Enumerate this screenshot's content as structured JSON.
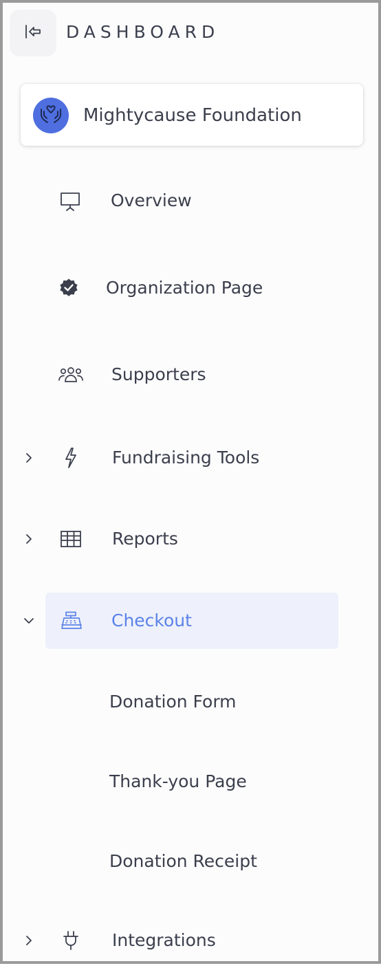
{
  "header": {
    "title": "DASHBOARD",
    "collapse_icon": "collapse-sidebar-icon"
  },
  "organization": {
    "name": "Mightycause Foundation",
    "avatar_icon": "hands-heart-icon",
    "avatar_color": "#4f6fe0"
  },
  "nav": {
    "overview": {
      "label": "Overview",
      "icon": "presentation-board-icon"
    },
    "organization_page": {
      "label": "Organization Page",
      "icon": "verified-badge-icon"
    },
    "supporters": {
      "label": "Supporters",
      "icon": "users-group-icon"
    },
    "fundraising_tools": {
      "label": "Fundraising Tools",
      "icon": "lightning-bolt-icon",
      "expanded": false
    },
    "reports": {
      "label": "Reports",
      "icon": "table-grid-icon",
      "expanded": false
    },
    "checkout": {
      "label": "Checkout",
      "icon": "cash-register-icon",
      "expanded": true,
      "active": true,
      "children": [
        {
          "label": "Donation Form"
        },
        {
          "label": "Thank-you Page"
        },
        {
          "label": "Donation Receipt"
        }
      ]
    },
    "integrations": {
      "label": "Integrations",
      "icon": "plug-icon",
      "expanded": false
    }
  },
  "colors": {
    "active_text": "#5b82e8",
    "active_background": "#eef1fb",
    "text": "#3b3f4c"
  }
}
